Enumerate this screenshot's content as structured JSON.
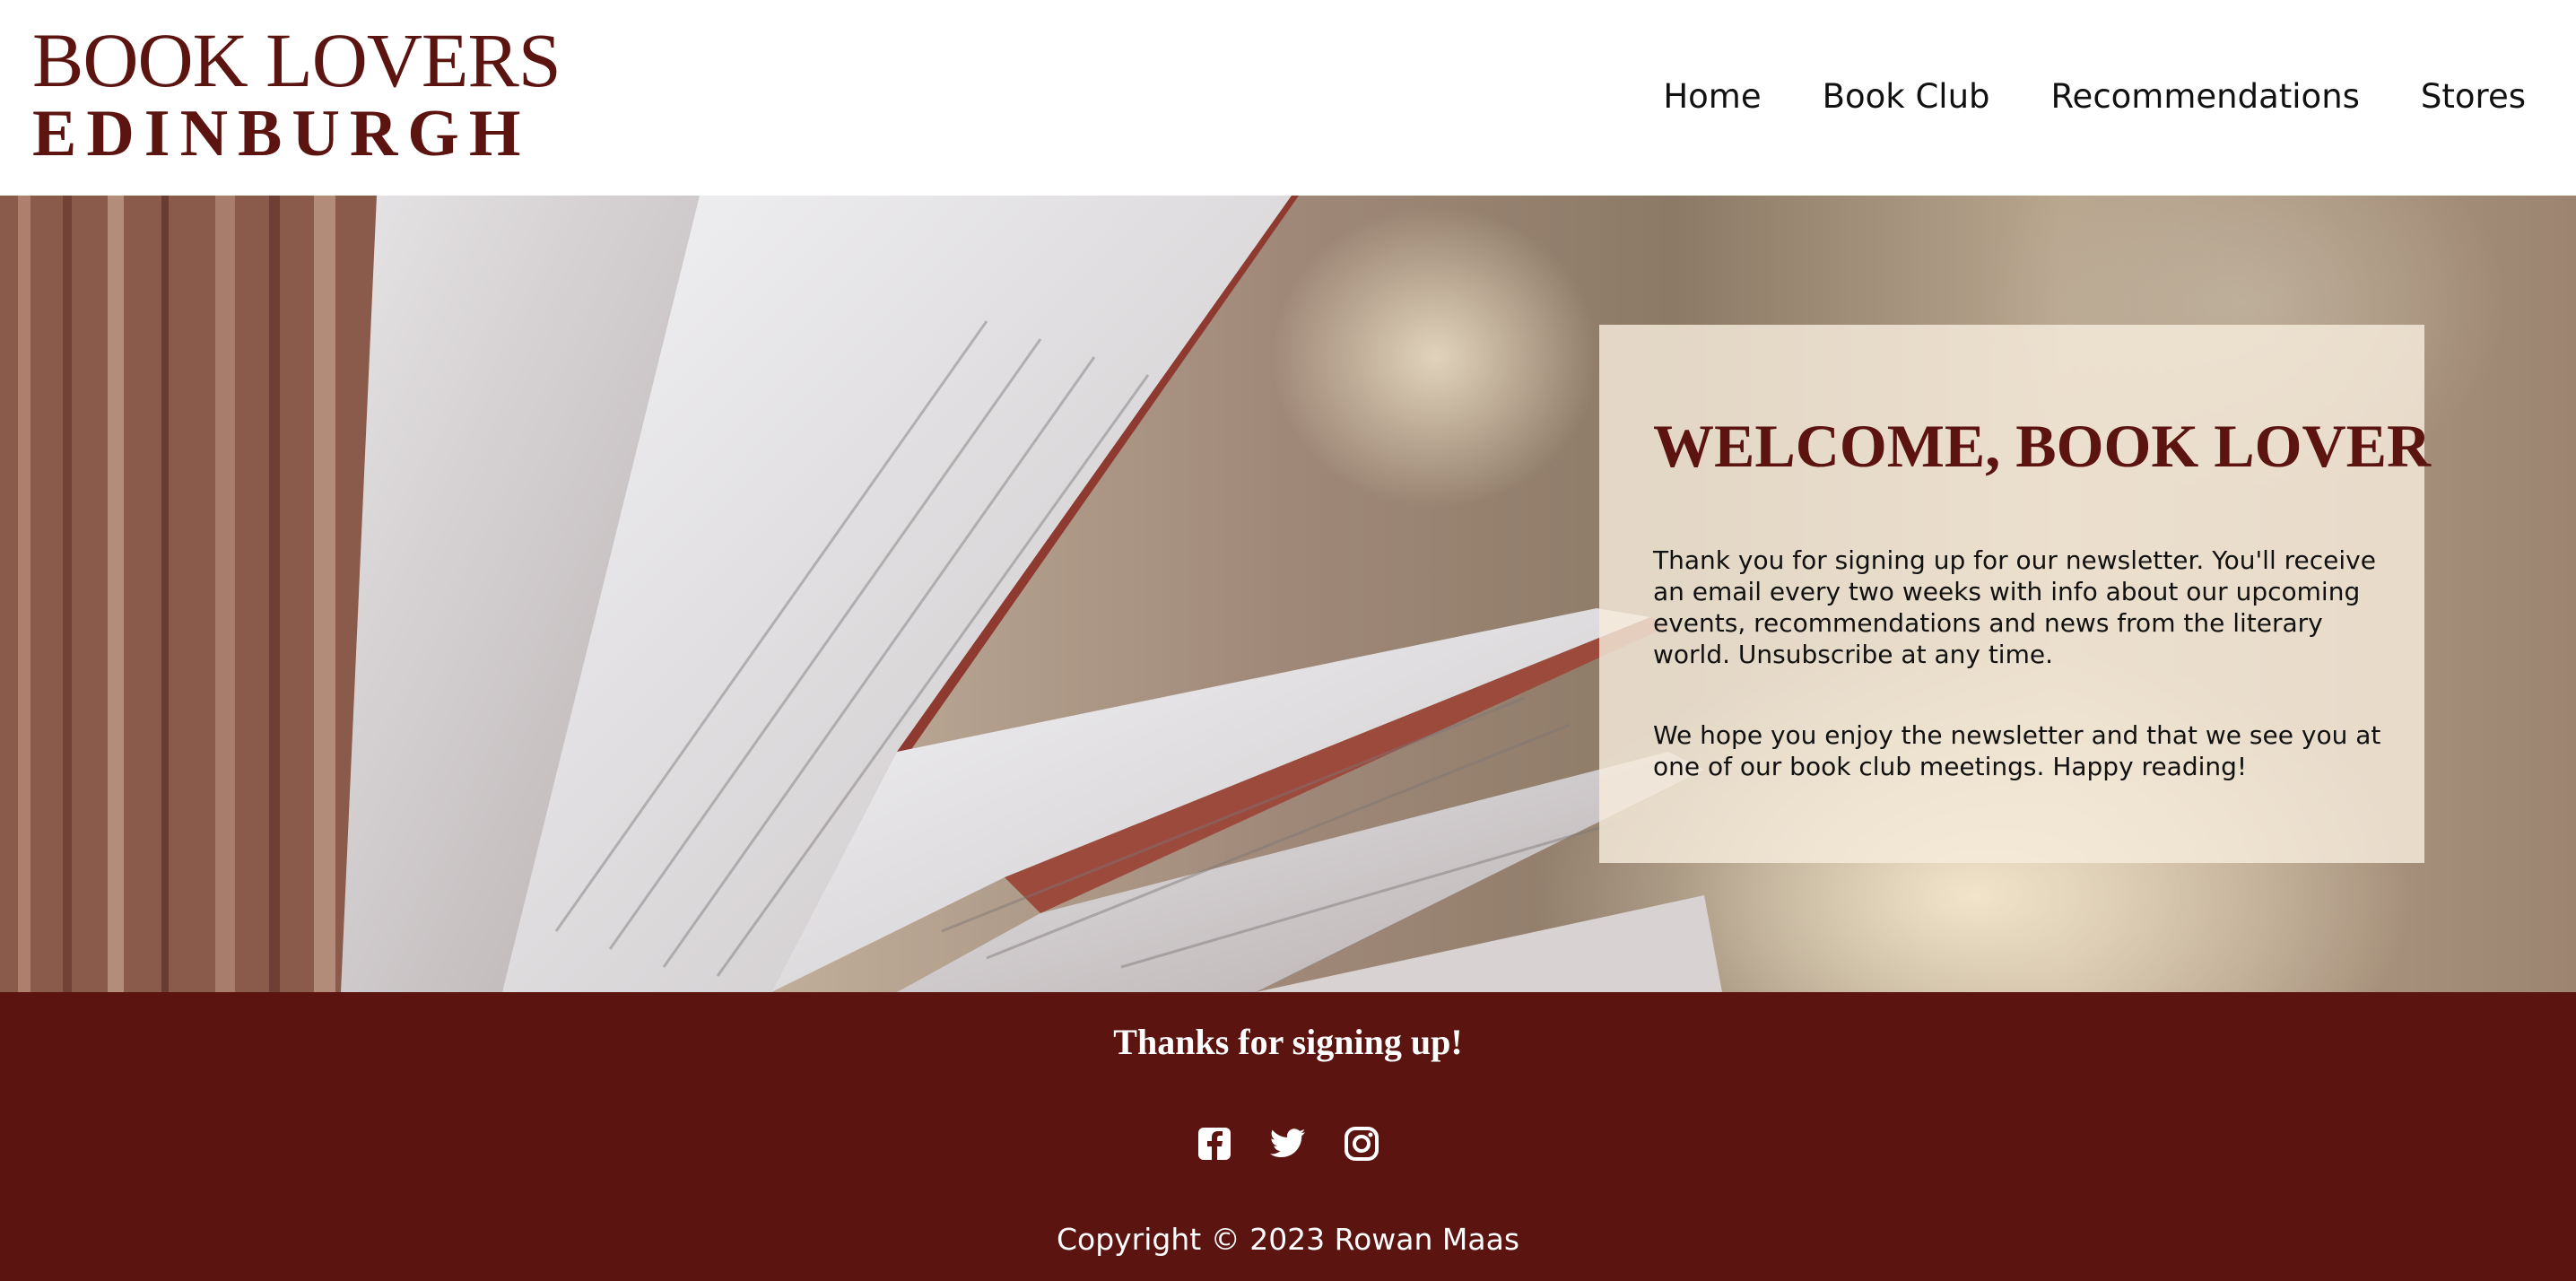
{
  "header": {
    "logo_line1": "BOOK LOVERS",
    "logo_line2": "EDINBURGH",
    "nav": [
      "Home",
      "Book Club",
      "Recommendations",
      "Stores"
    ]
  },
  "hero": {
    "title": "WELCOME, BOOK LOVER",
    "paragraph1": "Thank you for signing up for our newsletter. You'll receive an email every two weeks with info about our upcoming events, recommendations and news from the literary world. Unsubscribe at any time.",
    "paragraph2": "We hope you enjoy the newsletter and that we see you at one of our book club meetings. Happy reading!"
  },
  "footer": {
    "title": "Thanks for signing up!",
    "social_icons": [
      "facebook-icon",
      "twitter-icon",
      "instagram-icon"
    ],
    "copyright": "Copyright © 2023 Rowan Maas"
  },
  "colors": {
    "brand": "#5c1411",
    "text": "#111111",
    "card_bg": "#f6ecdc"
  }
}
